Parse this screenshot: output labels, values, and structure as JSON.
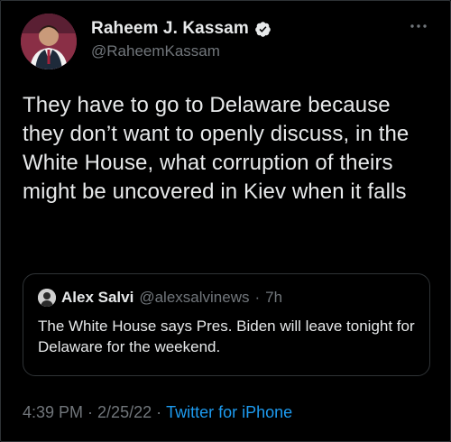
{
  "author": {
    "display_name": "Raheem J. Kassam",
    "handle": "@RaheemKassam",
    "icons": {
      "verified": "verified-badge-icon",
      "more": "more-options-icon"
    },
    "colors": {
      "verified": "#e7e9ea"
    }
  },
  "tweet": {
    "text": "They have to go to Delaware because they don’t want to openly discuss, in the White House, what corruption of theirs might be uncovered in Kiev when it falls"
  },
  "quote": {
    "name": "Alex Salvi",
    "handle": "@alexsalvinews",
    "separator": "·",
    "time": "7h",
    "text": "The White House says Pres. Biden will leave tonight for Delaware for the weekend."
  },
  "meta": {
    "time": "4:39 PM",
    "sep1": "·",
    "date": "2/25/22",
    "sep2": "·",
    "source": "Twitter for iPhone",
    "colors": {
      "link": "#1d9bf0",
      "muted": "#71767b"
    }
  }
}
